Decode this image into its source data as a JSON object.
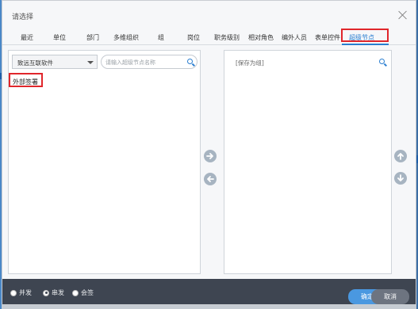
{
  "dialog": {
    "title": "请选择",
    "close_icon": "close-icon"
  },
  "tabs": [
    {
      "label": "最近",
      "active": false
    },
    {
      "label": "单位",
      "active": false
    },
    {
      "label": "部门",
      "active": false
    },
    {
      "label": "多维组织",
      "active": false
    },
    {
      "label": "组",
      "active": false
    },
    {
      "label": "岗位",
      "active": false
    },
    {
      "label": "职务级别",
      "active": false
    },
    {
      "label": "相对角色",
      "active": false
    },
    {
      "label": "编外人员",
      "active": false
    },
    {
      "label": "表单控件",
      "active": false
    },
    {
      "label": "超级节点",
      "active": true
    }
  ],
  "left_panel": {
    "org_select": {
      "value": "致远互联软件"
    },
    "search": {
      "placeholder": "请输入超级节点名称",
      "value": ""
    },
    "tree_items": [
      {
        "label": "外部签署",
        "selected": true
      }
    ]
  },
  "right_panel": {
    "header": "[保存为组]"
  },
  "transfer_buttons": {
    "add_icon": "arrow-right-icon",
    "remove_icon": "arrow-left-icon"
  },
  "order_buttons": {
    "up_icon": "arrow-up-icon",
    "down_icon": "arrow-down-icon"
  },
  "footer": {
    "options": [
      {
        "label": "并发",
        "checked": false
      },
      {
        "label": "串发",
        "checked": true
      },
      {
        "label": "会签",
        "checked": false
      }
    ],
    "ok_label": "确定",
    "cancel_label": "取消"
  },
  "colors": {
    "accent": "#2a7ed0",
    "highlight": "#e0262b",
    "footer_bg": "#3e4551",
    "ok_button": "#4a98e0"
  }
}
